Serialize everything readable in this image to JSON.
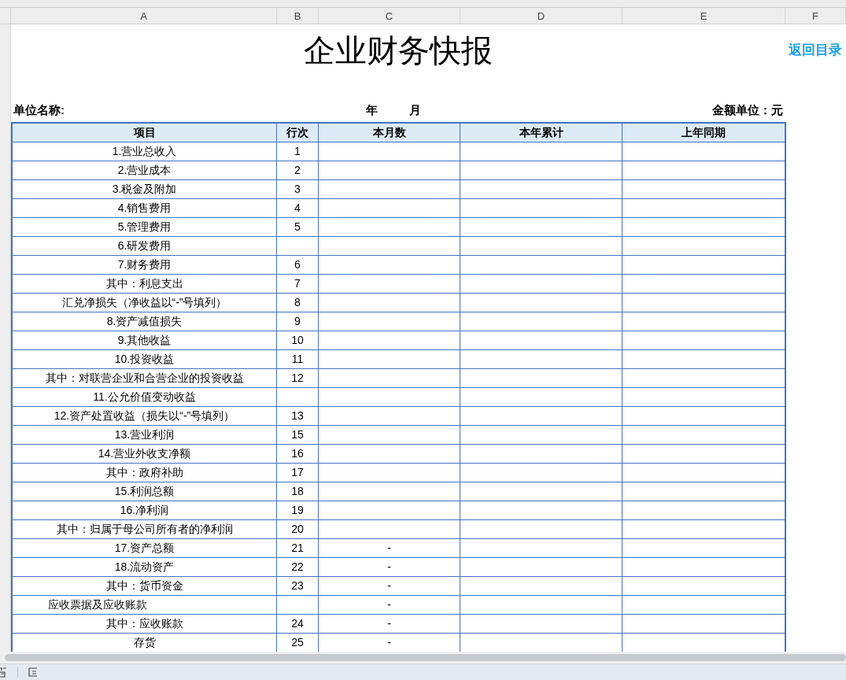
{
  "column_headers": [
    "A",
    "B",
    "C",
    "D",
    "E",
    "F"
  ],
  "title": "企业财务快报",
  "back_link": "返回目录",
  "unit_name_label": "单位名称:",
  "year_label": "年",
  "month_label": "月",
  "amount_unit_label": "金额单位：元",
  "table": {
    "columns": [
      "项目",
      "行次",
      "本月数",
      "本年累计",
      "上年同期"
    ],
    "rows": [
      {
        "kind": "centered",
        "item": "1.营业总收入",
        "line": "1",
        "current": ""
      },
      {
        "kind": "centered",
        "item": "2.营业成本",
        "line": "2",
        "current": ""
      },
      {
        "kind": "centered",
        "item": "3.税金及附加",
        "line": "3",
        "current": ""
      },
      {
        "kind": "centered",
        "item": "4.销售费用",
        "line": "4",
        "current": ""
      },
      {
        "kind": "centered",
        "item": "5.管理费用",
        "line": "5",
        "current": ""
      },
      {
        "kind": "centered",
        "item": "6.研发费用",
        "line": "",
        "current": ""
      },
      {
        "kind": "centered",
        "item": "7.财务费用",
        "line": "6",
        "current": ""
      },
      {
        "kind": "centered",
        "item": "其中：利息支出",
        "line": "7",
        "current": ""
      },
      {
        "kind": "centered",
        "item": "汇兑净损失（净收益以“-”号填列）",
        "line": "8",
        "current": ""
      },
      {
        "kind": "centered",
        "item": "8.资产减值损失",
        "line": "9",
        "current": ""
      },
      {
        "kind": "centered",
        "item": "9.其他收益",
        "line": "10",
        "current": ""
      },
      {
        "kind": "centered",
        "item": "10.投资收益",
        "line": "11",
        "current": ""
      },
      {
        "kind": "centered",
        "item": "其中：对联营企业和合营企业的投资收益",
        "line": "12",
        "current": ""
      },
      {
        "kind": "centered",
        "item": "11.公允价值变动收益",
        "line": "",
        "current": ""
      },
      {
        "kind": "centered",
        "item": "12.资产处置收益（损失以“-”号填列）",
        "line": "13",
        "current": ""
      },
      {
        "kind": "centered",
        "item": "13.营业利润",
        "line": "15",
        "current": ""
      },
      {
        "kind": "centered",
        "item": "14.营业外收支净额",
        "line": "16",
        "current": ""
      },
      {
        "kind": "centered",
        "item": "其中：政府补助",
        "line": "17",
        "current": ""
      },
      {
        "kind": "centered",
        "item": "15.利润总额",
        "line": "18",
        "current": ""
      },
      {
        "kind": "centered",
        "item": "16.净利润",
        "line": "19",
        "current": ""
      },
      {
        "kind": "centered",
        "item": "其中：归属于母公司所有者的净利润",
        "line": "20",
        "current": ""
      },
      {
        "kind": "centered",
        "item": "17.资产总额",
        "line": "21",
        "current": "-"
      },
      {
        "kind": "centered",
        "item": "18.流动资产",
        "line": "22",
        "current": "-"
      },
      {
        "kind": "centered",
        "item": "其中：货币资金",
        "line": "23",
        "current": "-"
      },
      {
        "kind": "indented",
        "item": "应收票据及应收账款",
        "line": "",
        "current": "-"
      },
      {
        "kind": "centered",
        "item": "其中：应收账款",
        "line": "24",
        "current": "-"
      },
      {
        "kind": "centered",
        "item": "存货",
        "line": "25",
        "current": "-"
      }
    ]
  }
}
